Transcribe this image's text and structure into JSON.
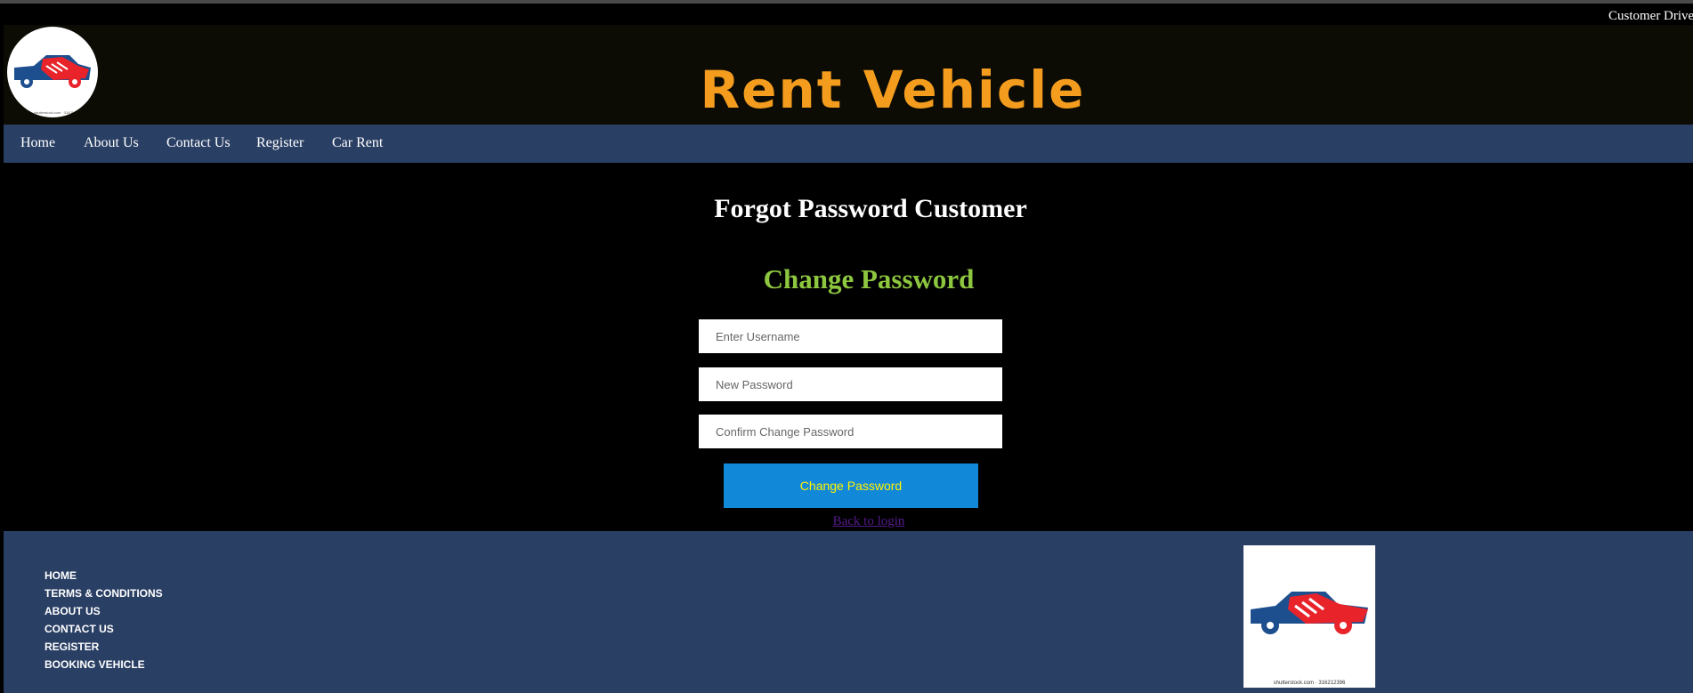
{
  "top_links": [
    "Customer",
    "Drive"
  ],
  "header": {
    "brand_title": "Rent Vehicle",
    "logo_tiny_text": "shutterstock.com · 316212396"
  },
  "nav": {
    "items": [
      "Home",
      "About Us",
      "Contact Us",
      "Register",
      "Car Rent"
    ]
  },
  "main": {
    "page_title": "Forgot Password Customer",
    "form_heading": "Change Password",
    "username_placeholder": "Enter Username",
    "new_password_placeholder": "New Password",
    "confirm_password_placeholder": "Confirm Change Password",
    "submit_label": "Change Password",
    "back_link": "Back to login"
  },
  "footer": {
    "links": [
      "HOME",
      "TERMS & CONDITIONS",
      "ABOUT US",
      "CONTACT US",
      "REGISTER",
      "BOOKING VEHICLE"
    ],
    "logo_credit": "shutterstock.com · 316212396"
  },
  "colors": {
    "brand": "#f39c1e",
    "nav_bg": "#2a3f64",
    "heading_green": "#8dc63f",
    "button_bg": "#1288d8",
    "button_text": "#fff200",
    "logo_red": "#e8232a",
    "logo_blue": "#1d4f8f"
  }
}
